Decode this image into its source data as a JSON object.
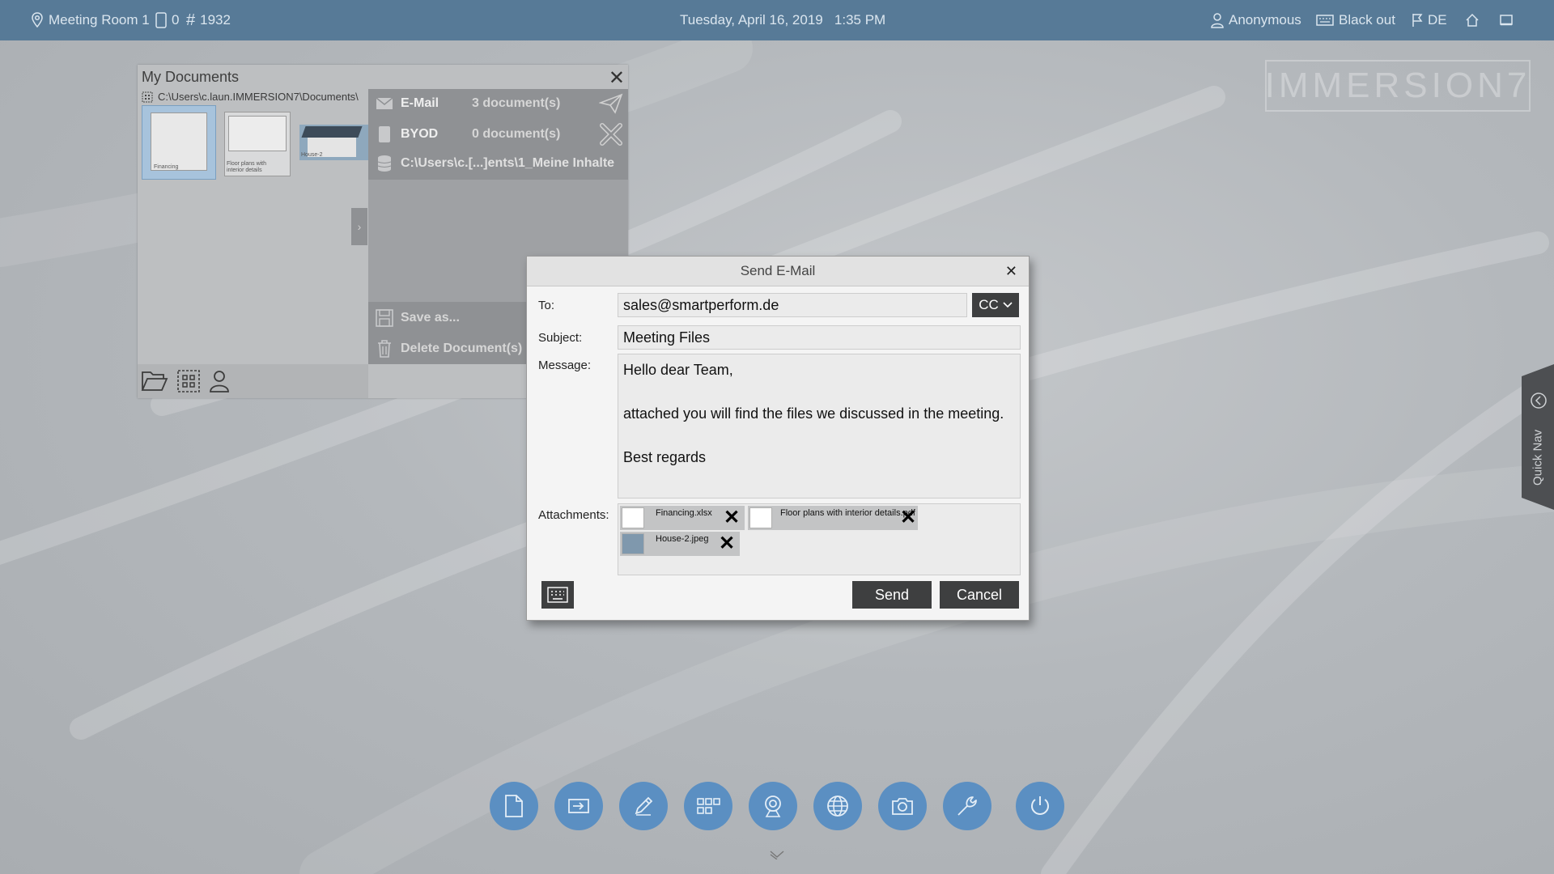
{
  "topbar": {
    "room": "Meeting Room 1",
    "devices": "0",
    "pin": "1932",
    "datetime": "Tuesday, April 16, 2019   1:35 PM",
    "user": "Anonymous",
    "blackout": "Black out",
    "language": "DE"
  },
  "logo": "IMMERSION7",
  "docs": {
    "title": "My Documents",
    "path": "C:\\Users\\c.laun.IMMERSION7\\Documents\\",
    "thumbs": [
      {
        "caption": "Financing"
      },
      {
        "caption": "Floor plans with interior details"
      },
      {
        "caption": "House-2"
      }
    ],
    "share": {
      "email_label": "E-Mail",
      "email_count": "3 document(s)",
      "byod_label": "BYOD",
      "byod_count": "0 document(s)",
      "folder": "C:\\Users\\c.[...]ents\\1_Meine Inhalte",
      "save_as": "Save as...",
      "delete": "Delete Document(s)"
    }
  },
  "dialog": {
    "title": "Send E-Mail",
    "to_label": "To:",
    "to_value": "sales@smartperform.de",
    "cc_label": "CC",
    "subject_label": "Subject:",
    "subject_value": "Meeting Files",
    "message_label": "Message:",
    "message_lines": [
      "Hello dear Team,",
      "",
      "attached you will find the files we discussed in the meeting.",
      "",
      "Best regards"
    ],
    "attachments_label": "Attachments:",
    "attachments": [
      "Financing.xlsx",
      "Floor plans with interior details.pdf",
      "House-2.jpeg"
    ],
    "send_label": "Send",
    "cancel_label": "Cancel"
  },
  "quick_nav": "Quick Nav",
  "colors": {
    "topbar": "#577a97",
    "dock_button": "#5b8fc2",
    "dialog_button": "#3e3f40"
  },
  "dock_icons": [
    "document-icon",
    "input-icon",
    "pen-icon",
    "apps-grid-icon",
    "webcam-icon",
    "globe-icon",
    "camera-icon",
    "wrench-icon",
    "power-icon"
  ]
}
